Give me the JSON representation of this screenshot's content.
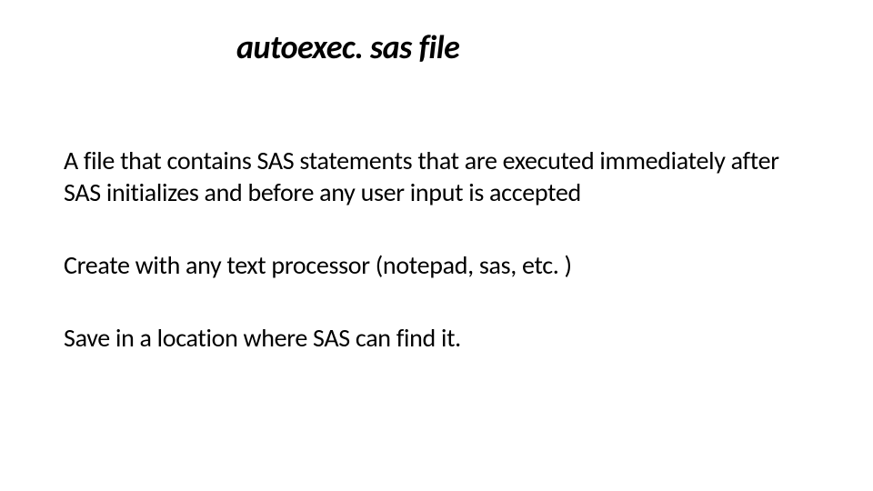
{
  "slide": {
    "title": "autoexec. sas file",
    "paragraphs": [
      "A file that contains SAS statements that are executed immediately after SAS initializes and before any user input is accepted",
      "Create with any text processor (notepad, sas, etc. )",
      "Save in a location where SAS can find it."
    ]
  }
}
